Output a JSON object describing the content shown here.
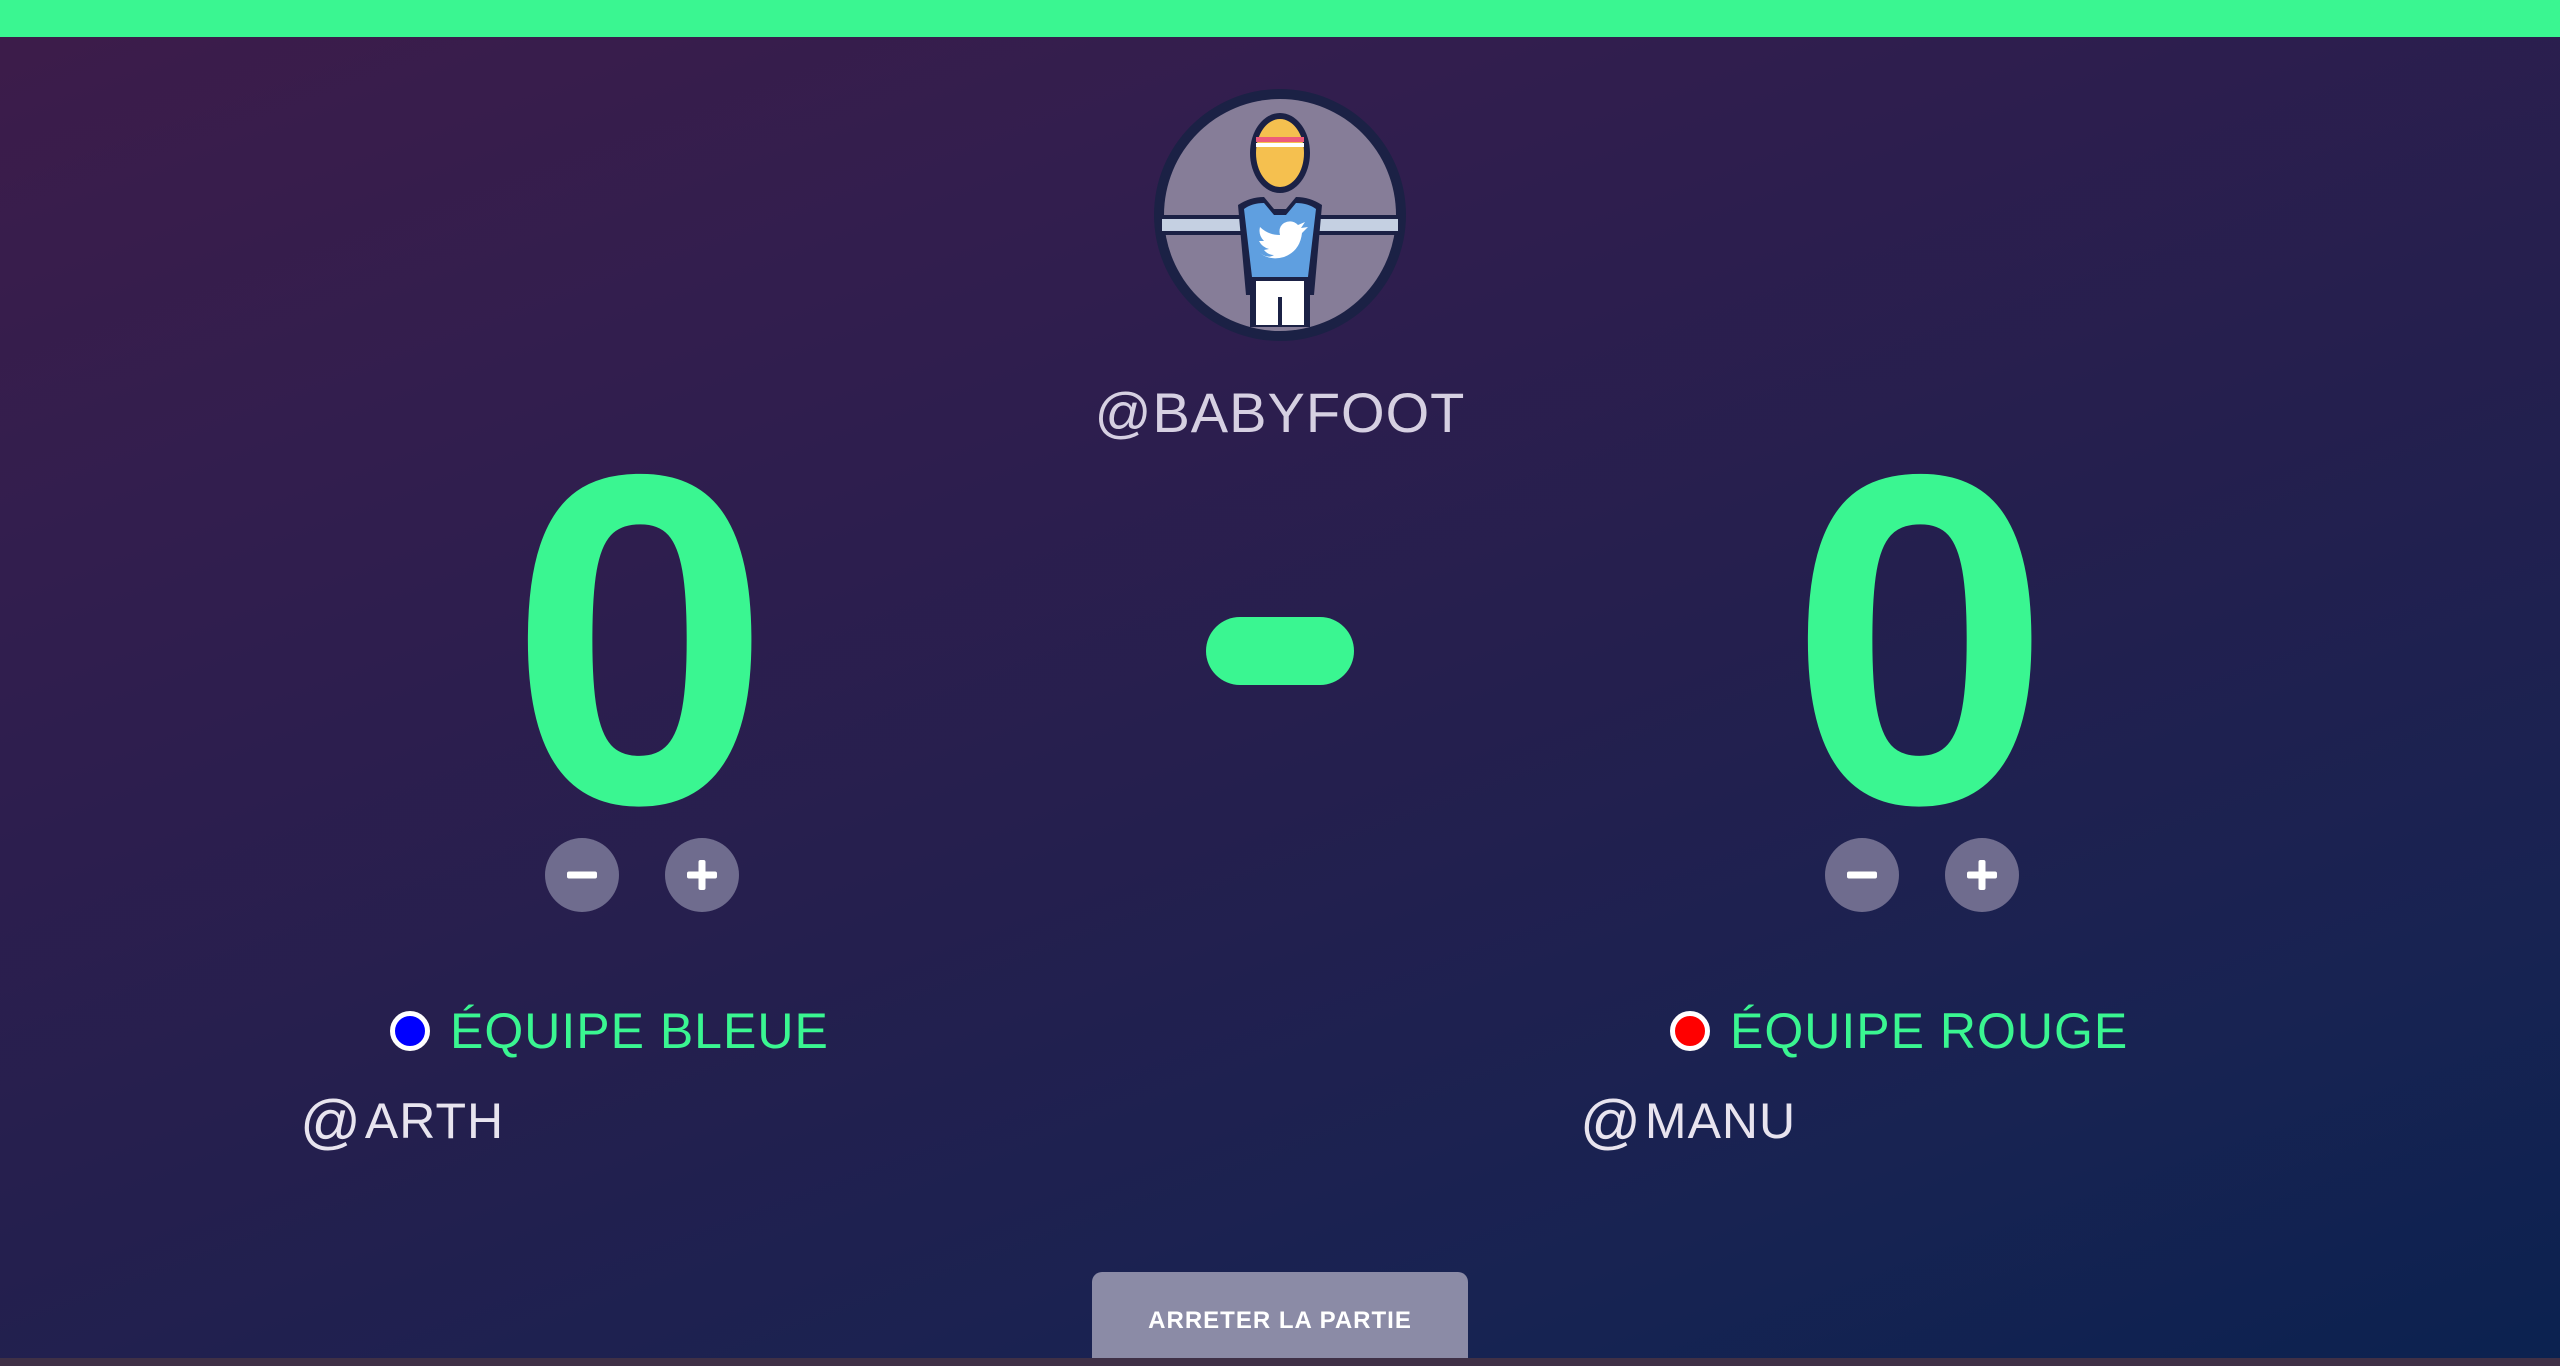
{
  "app": {
    "handle": "@BABYFOOT",
    "accent_color": "#3af691",
    "logo_icon": "foosball-player-twitter-icon"
  },
  "score": {
    "left": "0",
    "right": "0",
    "separator_icon": "dash-icon"
  },
  "controls": {
    "minus_icon": "minus-icon",
    "plus_icon": "plus-icon"
  },
  "teams": {
    "blue": {
      "name": "ÉQUIPE BLEUE",
      "color": "#0000ff",
      "player_at": "@",
      "player": "ARTH"
    },
    "red": {
      "name": "ÉQUIPE ROUGE",
      "color": "#ff0000",
      "player_at": "@",
      "player": "MANU"
    }
  },
  "actions": {
    "stop_label": "ARRETER LA PARTIE"
  }
}
